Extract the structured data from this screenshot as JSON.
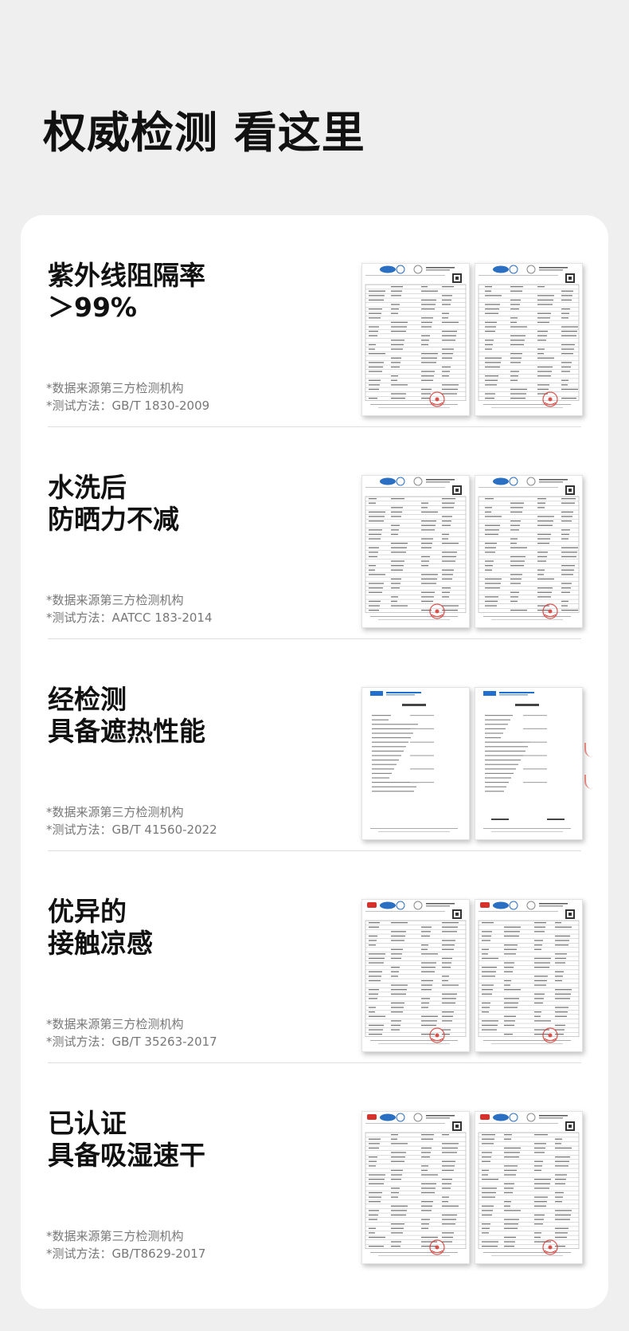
{
  "page": {
    "title": "权威检测 看这里"
  },
  "colors": {
    "stamp_red": "#d8302a",
    "note_gray": "#777777",
    "card_bg": "#ffffff",
    "page_bg": "#efefef"
  },
  "sections": [
    {
      "title_lines": [
        "紫外线阻隔率",
        "＞99%"
      ],
      "source": "*数据来源第三方检测机构",
      "method": "*测试方法：GB/T 1830-2009",
      "doc_style": "ntek"
    },
    {
      "title_lines": [
        "水洗后",
        "防晒力不减"
      ],
      "source": "*数据来源第三方检测机构",
      "method": "*测试方法：AATCC 183-2014",
      "doc_style": "ntek"
    },
    {
      "title_lines": [
        "经检测",
        "具备遮热性能"
      ],
      "source": "*数据来源第三方检测机构",
      "method": "*测试方法：GB/T 41560-2022",
      "doc_style": "smq"
    },
    {
      "title_lines": [
        "优异的",
        "接触凉感"
      ],
      "source": "*数据来源第三方检测机构",
      "method": "*测试方法：GB/T 35263-2017",
      "doc_style": "hta"
    },
    {
      "title_lines": [
        "已认证",
        "具备吸湿速干"
      ],
      "source": "*数据来源第三方检测机构",
      "method": "*测试方法：GB/T8629-2017",
      "doc_style": "hta"
    }
  ]
}
